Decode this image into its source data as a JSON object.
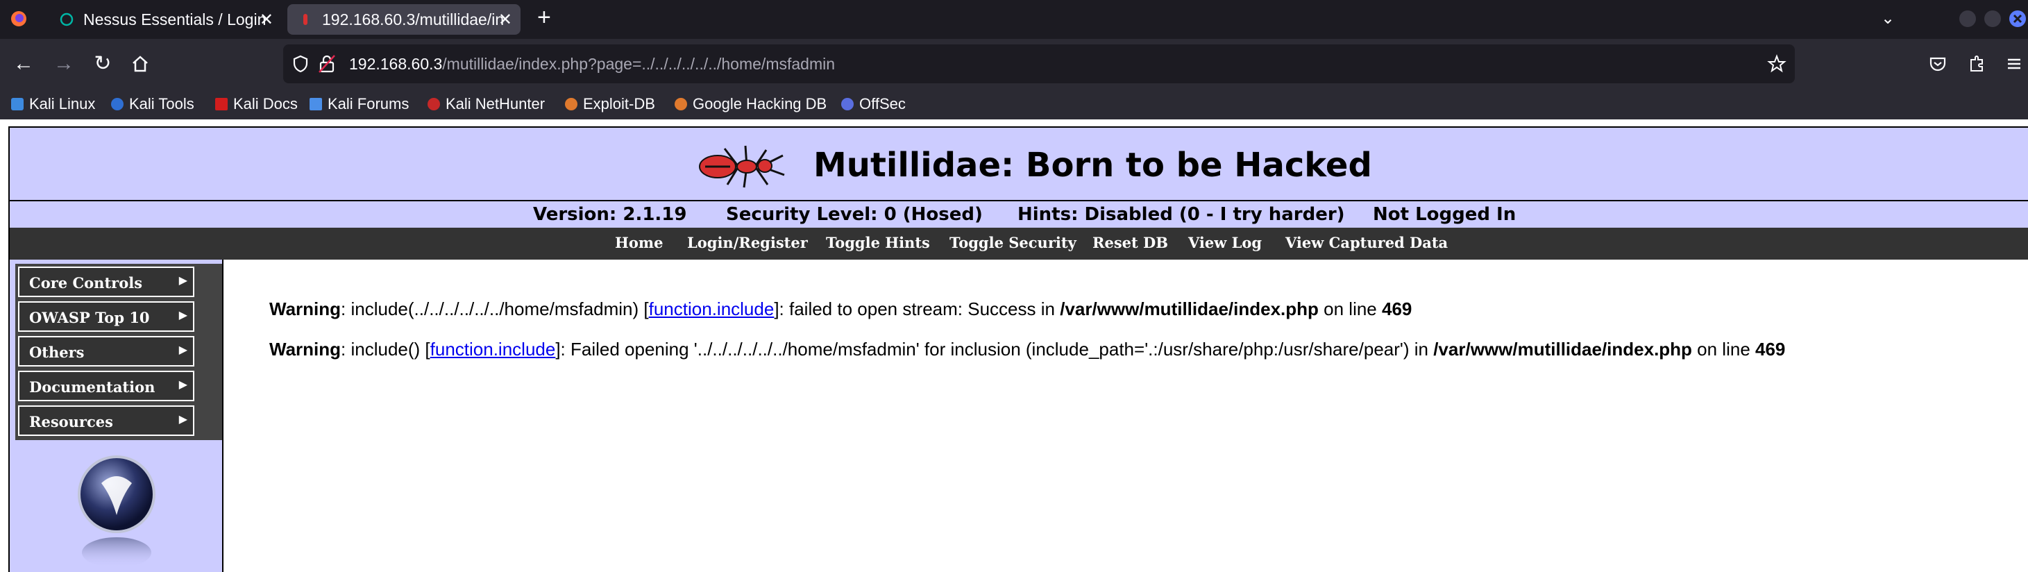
{
  "browser": {
    "tabs": [
      {
        "title": "Nessus Essentials / Login",
        "active": false
      },
      {
        "title": "192.168.60.3/mutillidae/in",
        "active": true
      }
    ],
    "new_tab_label": "+",
    "url_host": "192.168.60.3",
    "url_path": "/mutillidae/index.php?page=../../../../../../home/msfadmin",
    "bookmarks": [
      {
        "label": "Kali Linux",
        "icon": "kali-dragon-icon"
      },
      {
        "label": "Kali Tools",
        "icon": "kali-tools-icon"
      },
      {
        "label": "Kali Docs",
        "icon": "kali-docs-icon"
      },
      {
        "label": "Kali Forums",
        "icon": "kali-forums-icon"
      },
      {
        "label": "Kali NetHunter",
        "icon": "nethunter-icon"
      },
      {
        "label": "Exploit-DB",
        "icon": "exploit-db-icon"
      },
      {
        "label": "Google Hacking DB",
        "icon": "ghdb-icon"
      },
      {
        "label": "OffSec",
        "icon": "offsec-icon"
      }
    ]
  },
  "site": {
    "title": "Mutillidae: Born to be Hacked",
    "status": {
      "version": "Version: 2.1.19",
      "security": "Security Level: 0 (Hosed)",
      "hints": "Hints: Disabled (0 - I try harder)",
      "login": "Not Logged In"
    },
    "menu": [
      "Home",
      "Login/Register",
      "Toggle Hints",
      "Toggle Security",
      "Reset DB",
      "View Log",
      "View Captured Data"
    ],
    "sidebar": [
      "Core Controls",
      "OWASP Top 10",
      "Others",
      "Documentation",
      "Resources"
    ]
  },
  "warnings": [
    {
      "label": "Warning",
      "pre": ": include(../../../../../../home/msfadmin) [",
      "link": "function.include",
      "post": "]: failed to open stream: Success in ",
      "file": "/var/www/mutillidae/index.php",
      "online": " on line ",
      "line": "469"
    },
    {
      "label": "Warning",
      "pre": ": include() [",
      "link": "function.include",
      "post": "]: Failed opening '../../../../../../home/msfadmin' for inclusion (include_path='.:/usr/share/php:/usr/share/pear') in ",
      "file": "/var/www/mutillidae/index.php",
      "online": " on line ",
      "line": "469"
    }
  ],
  "colors": {
    "header_bg": "#ccccff",
    "menu_bg": "#333333",
    "link": "#0000ee",
    "chrome_dark": "#1c1b22",
    "chrome_toolbar": "#2b2a33"
  }
}
